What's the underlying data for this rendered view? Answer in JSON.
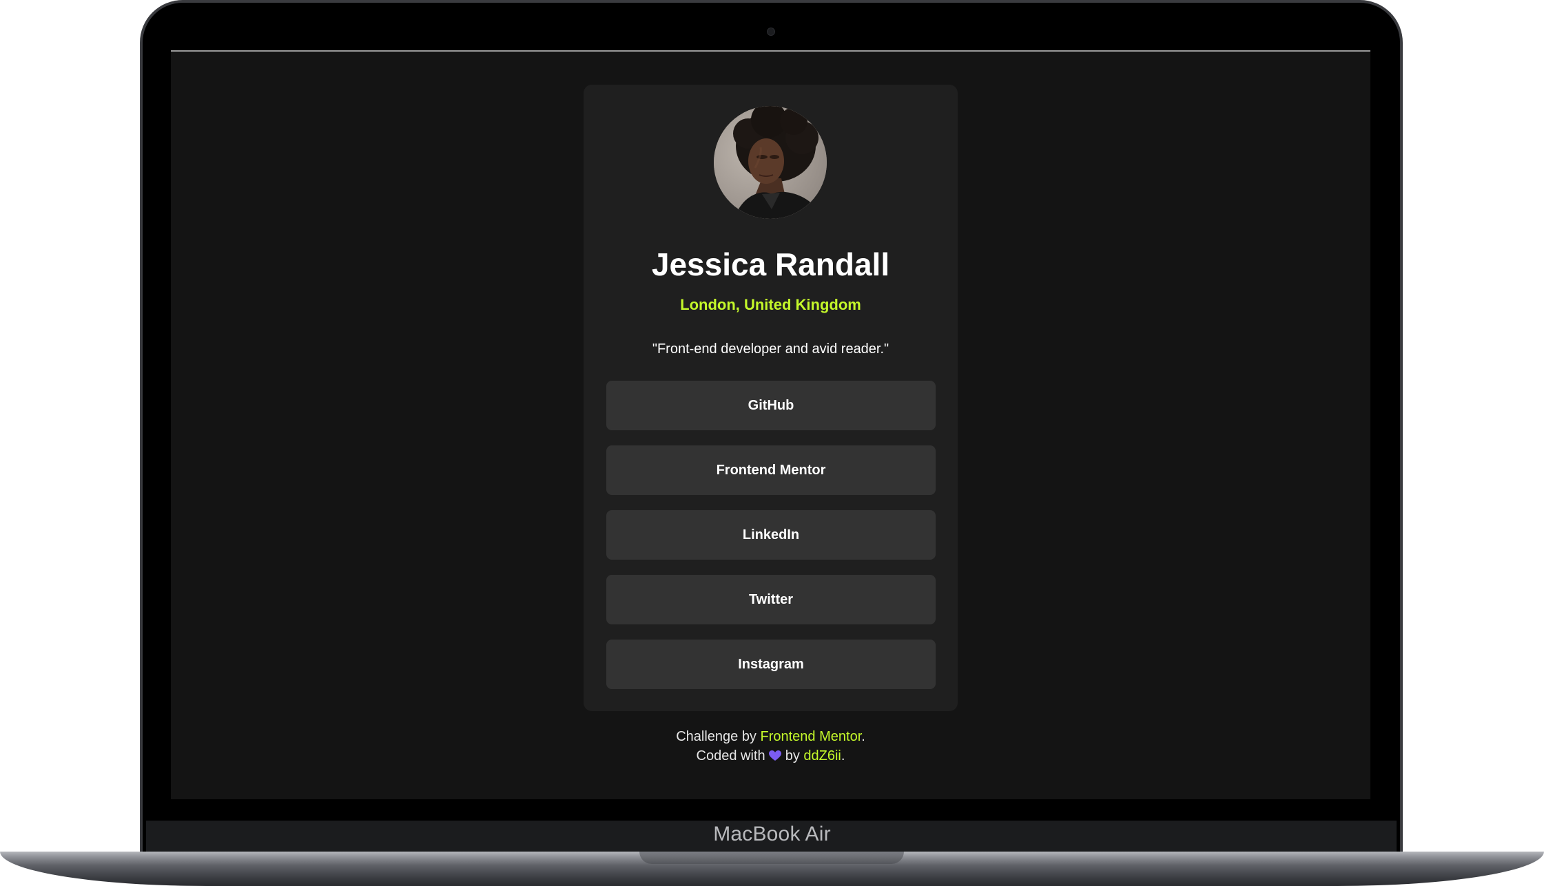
{
  "profile": {
    "name": "Jessica Randall",
    "location": "London, United Kingdom",
    "bio": "\"Front-end developer and avid reader.\""
  },
  "links": [
    {
      "label": "GitHub"
    },
    {
      "label": "Frontend Mentor"
    },
    {
      "label": "LinkedIn"
    },
    {
      "label": "Twitter"
    },
    {
      "label": "Instagram"
    }
  ],
  "footer": {
    "challenge_prefix": "Challenge by ",
    "challenge_link": "Frontend Mentor",
    "challenge_suffix": ".",
    "coded_prefix": "Coded with ",
    "coded_by": " by ",
    "author_link": "ddZ6ii",
    "author_suffix": "."
  },
  "device": {
    "label": "MacBook Air"
  },
  "colors": {
    "background": "#141414",
    "card": "#1f1f1f",
    "button": "#333333",
    "accent": "#c4f82a",
    "heart": "#7b5cf0"
  },
  "icons": {
    "heart": "heart-icon"
  }
}
